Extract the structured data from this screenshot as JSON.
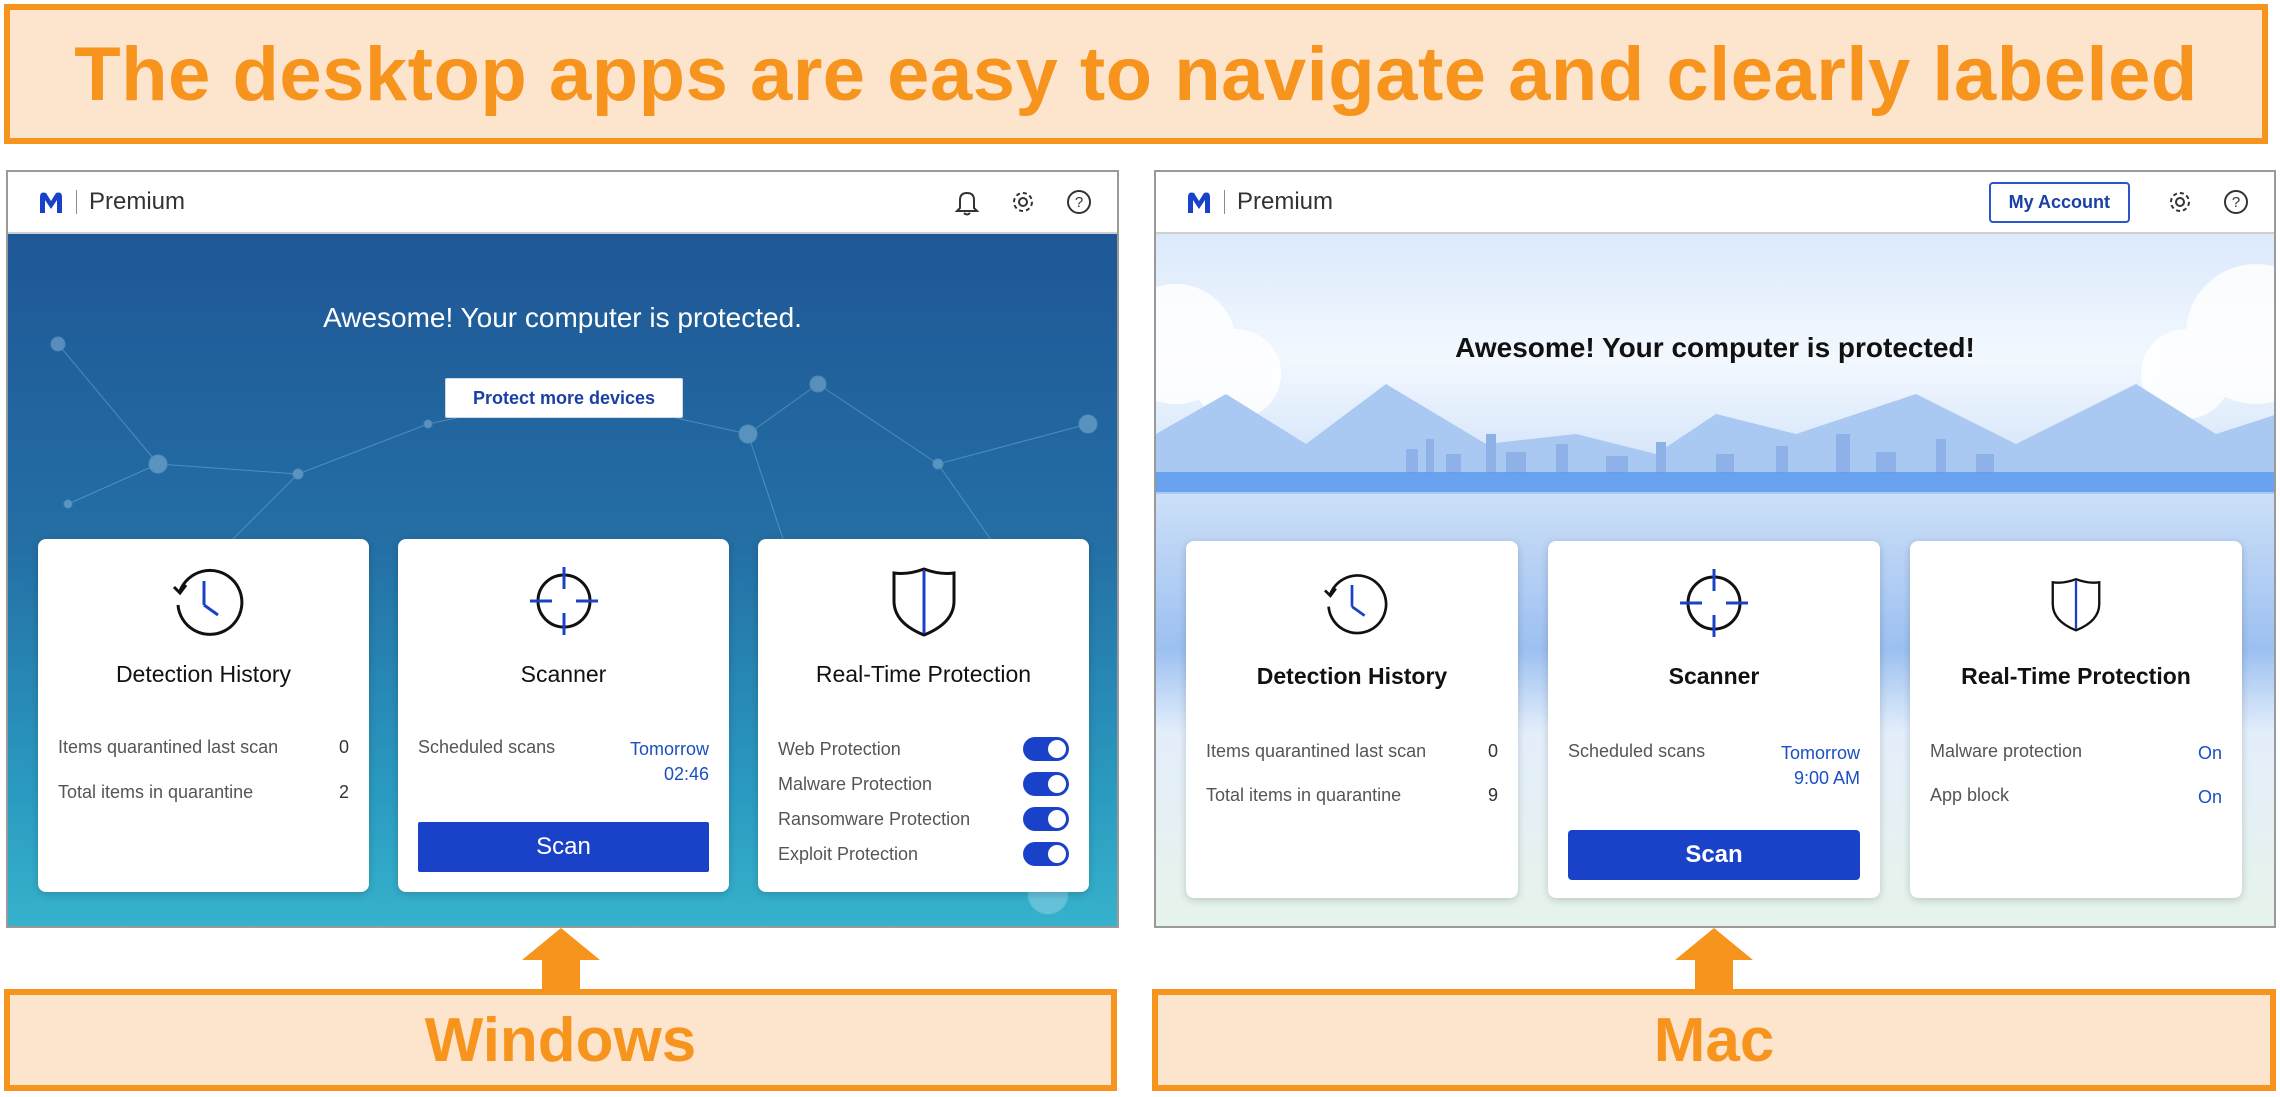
{
  "banner": {
    "text": "The desktop apps are easy to navigate and clearly labeled"
  },
  "colors": {
    "accent_orange": "#f7941d",
    "banner_bg": "#fde4cc",
    "malwarebytes_blue": "#1a42c9"
  },
  "windows_app": {
    "brand": "Premium",
    "icons": [
      "bell-icon",
      "gear-icon",
      "help-icon"
    ],
    "hero_title": "Awesome! Your computer is protected.",
    "protect_button": "Protect more devices",
    "detection_history": {
      "title": "Detection History",
      "rows": [
        {
          "label": "Items quarantined last scan",
          "value": "0"
        },
        {
          "label": "Total items in quarantine",
          "value": "2"
        }
      ]
    },
    "scanner": {
      "title": "Scanner",
      "scheduled_label": "Scheduled scans",
      "scheduled_day": "Tomorrow",
      "scheduled_time": "02:46",
      "scan_button": "Scan"
    },
    "realtime": {
      "title": "Real-Time Protection",
      "toggles": [
        {
          "label": "Web Protection",
          "on": true
        },
        {
          "label": "Malware Protection",
          "on": true
        },
        {
          "label": "Ransomware Protection",
          "on": true
        },
        {
          "label": "Exploit Protection",
          "on": true
        }
      ]
    },
    "platform_label": "Windows"
  },
  "mac_app": {
    "brand": "Premium",
    "account_button": "My Account",
    "icons": [
      "gear-icon",
      "help-icon"
    ],
    "hero_title": "Awesome! Your computer is protected!",
    "detection_history": {
      "title": "Detection History",
      "rows": [
        {
          "label": "Items quarantined last scan",
          "value": "0"
        },
        {
          "label": "Total items in quarantine",
          "value": "9"
        }
      ]
    },
    "scanner": {
      "title": "Scanner",
      "scheduled_label": "Scheduled scans",
      "scheduled_day": "Tomorrow",
      "scheduled_time": "9:00 AM",
      "scan_button": "Scan"
    },
    "realtime": {
      "title": "Real-Time Protection",
      "rows": [
        {
          "label": "Malware protection",
          "value": "On"
        },
        {
          "label": "App block",
          "value": "On"
        }
      ]
    },
    "platform_label": "Mac"
  }
}
